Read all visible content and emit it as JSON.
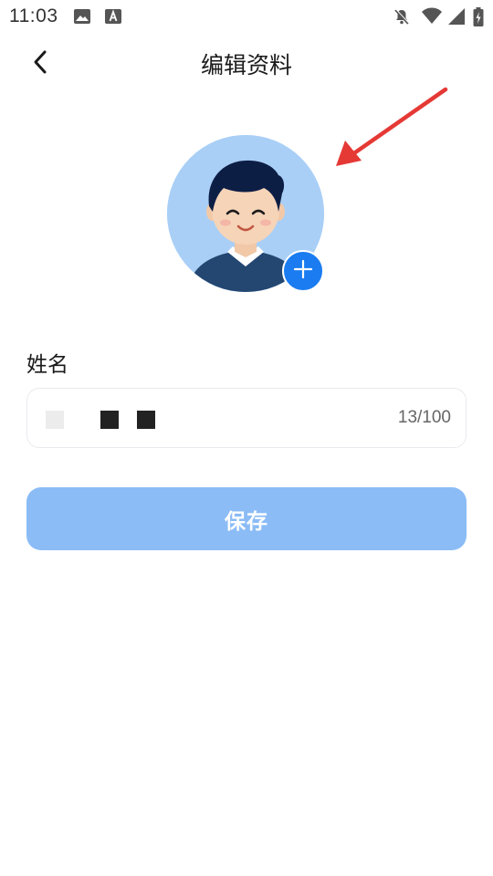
{
  "status_bar": {
    "time": "11:03",
    "left_icons": [
      "image-icon",
      "text-a-icon"
    ],
    "right_icons": [
      "notifications-off-icon",
      "wifi-icon",
      "signal-icon",
      "battery-charging-icon"
    ]
  },
  "header": {
    "title": "编辑资料",
    "back_icon": "chevron-left-icon"
  },
  "avatar": {
    "add_icon": "plus-icon",
    "accent": "#1a7cf0",
    "background": "#a9cff6"
  },
  "annotation": {
    "arrow_color": "#e53935"
  },
  "name_field": {
    "label": "姓名",
    "char_count": "13/100"
  },
  "save_button": {
    "label": "保存",
    "color": "#8bbcf6"
  }
}
